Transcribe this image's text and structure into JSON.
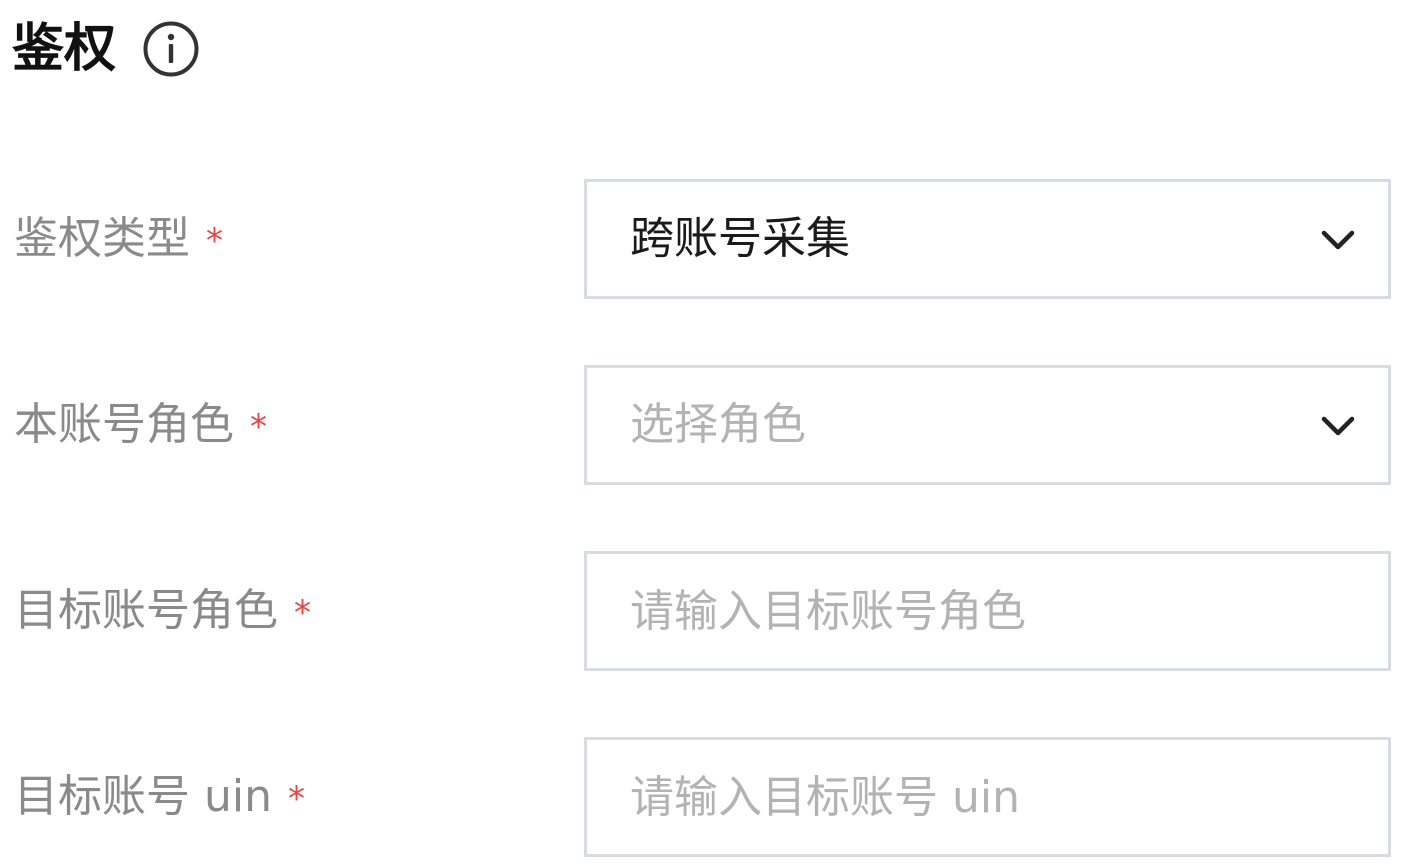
{
  "section": {
    "title": "鉴权",
    "info_icon": "info-circle-icon"
  },
  "fields": [
    {
      "label": "鉴权类型",
      "required_mark": "*",
      "type": "select",
      "value": "跨账号采集",
      "icon": "chevron-down-icon"
    },
    {
      "label": "本账号角色",
      "required_mark": "*",
      "type": "select",
      "placeholder": "选择角色",
      "icon": "chevron-down-icon"
    },
    {
      "label": "目标账号角色",
      "required_mark": "*",
      "type": "input",
      "placeholder": "请输入目标账号角色"
    },
    {
      "label": "目标账号 uin",
      "required_mark": "*",
      "type": "input",
      "placeholder": "请输入目标账号 uin"
    }
  ],
  "colors": {
    "label": "#8a8a8a",
    "required": "#e54545",
    "border": "#d7dce3",
    "value": "#1a1a1a",
    "placeholder": "#b3b3b3"
  }
}
